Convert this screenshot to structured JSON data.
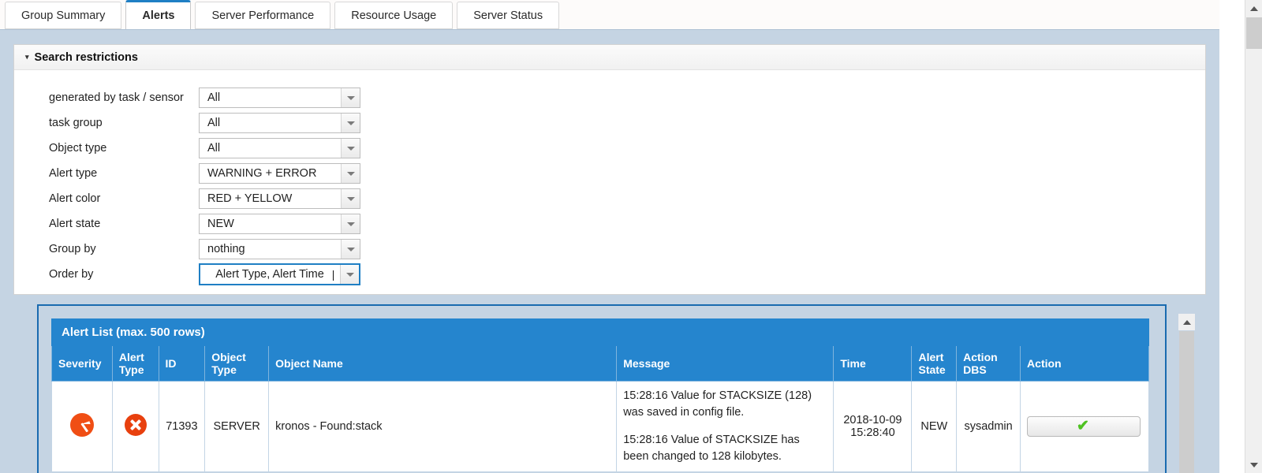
{
  "tabs": [
    {
      "label": "Group Summary",
      "active": false
    },
    {
      "label": "Alerts",
      "active": true
    },
    {
      "label": "Server Performance",
      "active": false
    },
    {
      "label": "Resource Usage",
      "active": false
    },
    {
      "label": "Server Status",
      "active": false
    }
  ],
  "search_panel": {
    "title": "Search restrictions",
    "caret": "▾",
    "fields": [
      {
        "label": "generated by task / sensor",
        "value": "All",
        "focused": false
      },
      {
        "label": "task group",
        "value": "All",
        "focused": false
      },
      {
        "label": "Object type",
        "value": "All",
        "focused": false
      },
      {
        "label": "Alert type",
        "value": "WARNING + ERROR",
        "focused": false
      },
      {
        "label": "Alert color",
        "value": "RED + YELLOW",
        "focused": false
      },
      {
        "label": "Alert state",
        "value": "NEW",
        "focused": false
      },
      {
        "label": "Group by",
        "value": "nothing",
        "focused": false
      },
      {
        "label": "Order by",
        "value": "Alert Type, Alert Time",
        "focused": true
      }
    ]
  },
  "alert_list": {
    "title": "Alert List (max. 500 rows)",
    "columns": [
      "Severity",
      "Alert Type",
      "ID",
      "Object Type",
      "Object Name",
      "Message",
      "Time",
      "Alert State",
      "Action DBS",
      "Action"
    ],
    "rows": [
      {
        "severity_icon": "severity-gauge-icon",
        "alert_type_icon": "error-x-icon",
        "id": "71393",
        "object_type": "SERVER",
        "object_name": "kronos - Found:stack",
        "message_lines": [
          "15:28:16 Value for STACKSIZE (128) was saved in config file.",
          "15:28:16 Value of STACKSIZE has been changed to 128 kilobytes."
        ],
        "time": "2018-10-09 15:28:40",
        "alert_state": "NEW",
        "action_dbs": "sysadmin",
        "action_icon": "check-icon",
        "action_glyph": "✔"
      }
    ]
  },
  "colors": {
    "page_background": "#c5d4e3",
    "table_header": "#2585ce",
    "accent_blue": "#1f7fc4",
    "frame_blue": "#1a6bb0",
    "severity_orange": "#f04e14",
    "error_red": "#e8400e",
    "check_green": "#4fc222"
  },
  "scrollbars": {
    "outer": {
      "name": "outer-vertical-scrollbar"
    },
    "inner": {
      "name": "inner-vertical-scrollbar"
    }
  }
}
